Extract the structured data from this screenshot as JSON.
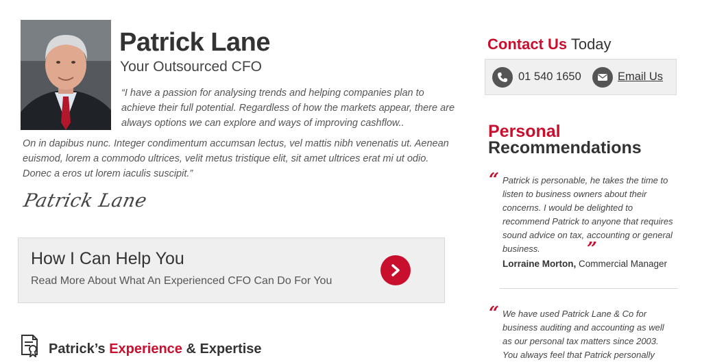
{
  "profile": {
    "name": "Patrick Lane",
    "subtitle": "Your Outsourced CFO",
    "quote_part1": "“I have a passion for analysing trends and helping companies plan to achieve their full potential. Regardless of how the markets appear, there are always options we can explore and ways of improving cashflow..",
    "quote_part2": "On in dapibus nunc. Integer condimentum accumsan lectus, vel mattis nibh venenatis ut. Aenean euismod, lorem a commodo ultrices, velit metus tristique elit, sit amet ultrices erat mi ut odio. Donec a eros ut lorem iaculis suscipit.”",
    "signature": "Patrick Lane"
  },
  "help": {
    "title": "How I Can Help You",
    "subtitle": "Read More About What An Experienced CFO Can Do For You",
    "arrow_icon": "chevron-right-icon"
  },
  "experience": {
    "prefix": "Patrick’s ",
    "highlight": "Experience",
    "suffix": " & Expertise",
    "icon": "certificate-icon"
  },
  "contact": {
    "heading_highlight": "Contact Us",
    "heading_rest": " Today",
    "phone": "01 540 1650",
    "email_label": "Email Us"
  },
  "recommendations": {
    "heading_line1": "Personal",
    "heading_line2": "Recommendations",
    "items": [
      {
        "text": "Patrick is personable, he takes the time to listen to business owners about their concerns. I would be delighted to recommend Patrick to anyone that requires sound advice on tax, accounting or general business.",
        "author": "Lorraine Morton,",
        "role": " Commercial Manager"
      },
      {
        "text": "We have used Patrick Lane & Co for business auditing and accounting as well as our personal tax matters since 2003. You always feel that Patrick personally"
      }
    ]
  },
  "colors": {
    "accent": "#c8102e",
    "text": "#333333",
    "panel": "#efefef"
  }
}
